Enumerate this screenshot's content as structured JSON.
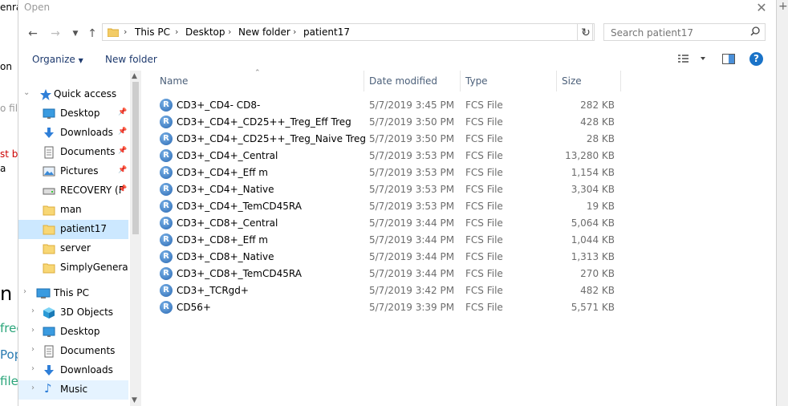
{
  "background": {
    "fragments": [
      "enra",
      "on",
      "o fil",
      "st be",
      "a",
      "n",
      "frec",
      "Pop",
      "file"
    ]
  },
  "dialog": {
    "title": "Open",
    "close_label": "✕"
  },
  "address": {
    "crumbs": [
      "This PC",
      "Desktop",
      "New folder",
      "patient17"
    ]
  },
  "search": {
    "placeholder": "Search patient17"
  },
  "toolbar": {
    "organize_label": "Organize",
    "new_folder_label": "New folder"
  },
  "nav": {
    "items": [
      {
        "label": "Quick access",
        "icon": "star-icon"
      },
      {
        "label": "Desktop",
        "icon": "desktop-icon",
        "pinned": true
      },
      {
        "label": "Downloads",
        "icon": "download-icon",
        "pinned": true
      },
      {
        "label": "Documents",
        "icon": "documents-icon",
        "pinned": true
      },
      {
        "label": "Pictures",
        "icon": "pictures-icon",
        "pinned": true
      },
      {
        "label": "RECOVERY (F",
        "icon": "drive-icon",
        "pinned": true
      },
      {
        "label": "man",
        "icon": "folder-icon"
      },
      {
        "label": "patient17",
        "icon": "folder-icon",
        "selected": true
      },
      {
        "label": "server",
        "icon": "folder-icon"
      },
      {
        "label": "SimplyGenerateF",
        "icon": "folder-icon"
      },
      {
        "label": "This PC",
        "icon": "computer-icon"
      },
      {
        "label": "3D Objects",
        "icon": "cube-icon"
      },
      {
        "label": "Desktop",
        "icon": "desktop-icon"
      },
      {
        "label": "Documents",
        "icon": "documents-icon"
      },
      {
        "label": "Downloads",
        "icon": "download-icon"
      },
      {
        "label": "Music",
        "icon": "music-icon",
        "highlighted": true
      }
    ]
  },
  "columns": {
    "name": "Name",
    "date": "Date modified",
    "type": "Type",
    "size": "Size"
  },
  "files": [
    {
      "name": "CD3+_CD4- CD8-",
      "date": "5/7/2019 3:45 PM",
      "type": "FCS File",
      "size": "282 KB"
    },
    {
      "name": "CD3+_CD4+_CD25++_Treg_Eff Treg",
      "date": "5/7/2019 3:50 PM",
      "type": "FCS File",
      "size": "428 KB"
    },
    {
      "name": "CD3+_CD4+_CD25++_Treg_Naive Treg",
      "date": "5/7/2019 3:50 PM",
      "type": "FCS File",
      "size": "28 KB"
    },
    {
      "name": "CD3+_CD4+_Central",
      "date": "5/7/2019 3:53 PM",
      "type": "FCS File",
      "size": "13,280 KB"
    },
    {
      "name": "CD3+_CD4+_Eff m",
      "date": "5/7/2019 3:53 PM",
      "type": "FCS File",
      "size": "1,154 KB"
    },
    {
      "name": "CD3+_CD4+_Native",
      "date": "5/7/2019 3:53 PM",
      "type": "FCS File",
      "size": "3,304 KB"
    },
    {
      "name": "CD3+_CD4+_TemCD45RA",
      "date": "5/7/2019 3:53 PM",
      "type": "FCS File",
      "size": "19 KB"
    },
    {
      "name": "CD3+_CD8+_Central",
      "date": "5/7/2019 3:44 PM",
      "type": "FCS File",
      "size": "5,064 KB"
    },
    {
      "name": "CD3+_CD8+_Eff m",
      "date": "5/7/2019 3:44 PM",
      "type": "FCS File",
      "size": "1,044 KB"
    },
    {
      "name": "CD3+_CD8+_Native",
      "date": "5/7/2019 3:44 PM",
      "type": "FCS File",
      "size": "1,313 KB"
    },
    {
      "name": "CD3+_CD8+_TemCD45RA",
      "date": "5/7/2019 3:44 PM",
      "type": "FCS File",
      "size": "270 KB"
    },
    {
      "name": "CD3+_TCRgd+",
      "date": "5/7/2019 3:42 PM",
      "type": "FCS File",
      "size": "482 KB"
    },
    {
      "name": "CD56+",
      "date": "5/7/2019 3:39 PM",
      "type": "FCS File",
      "size": "5,571 KB"
    }
  ]
}
